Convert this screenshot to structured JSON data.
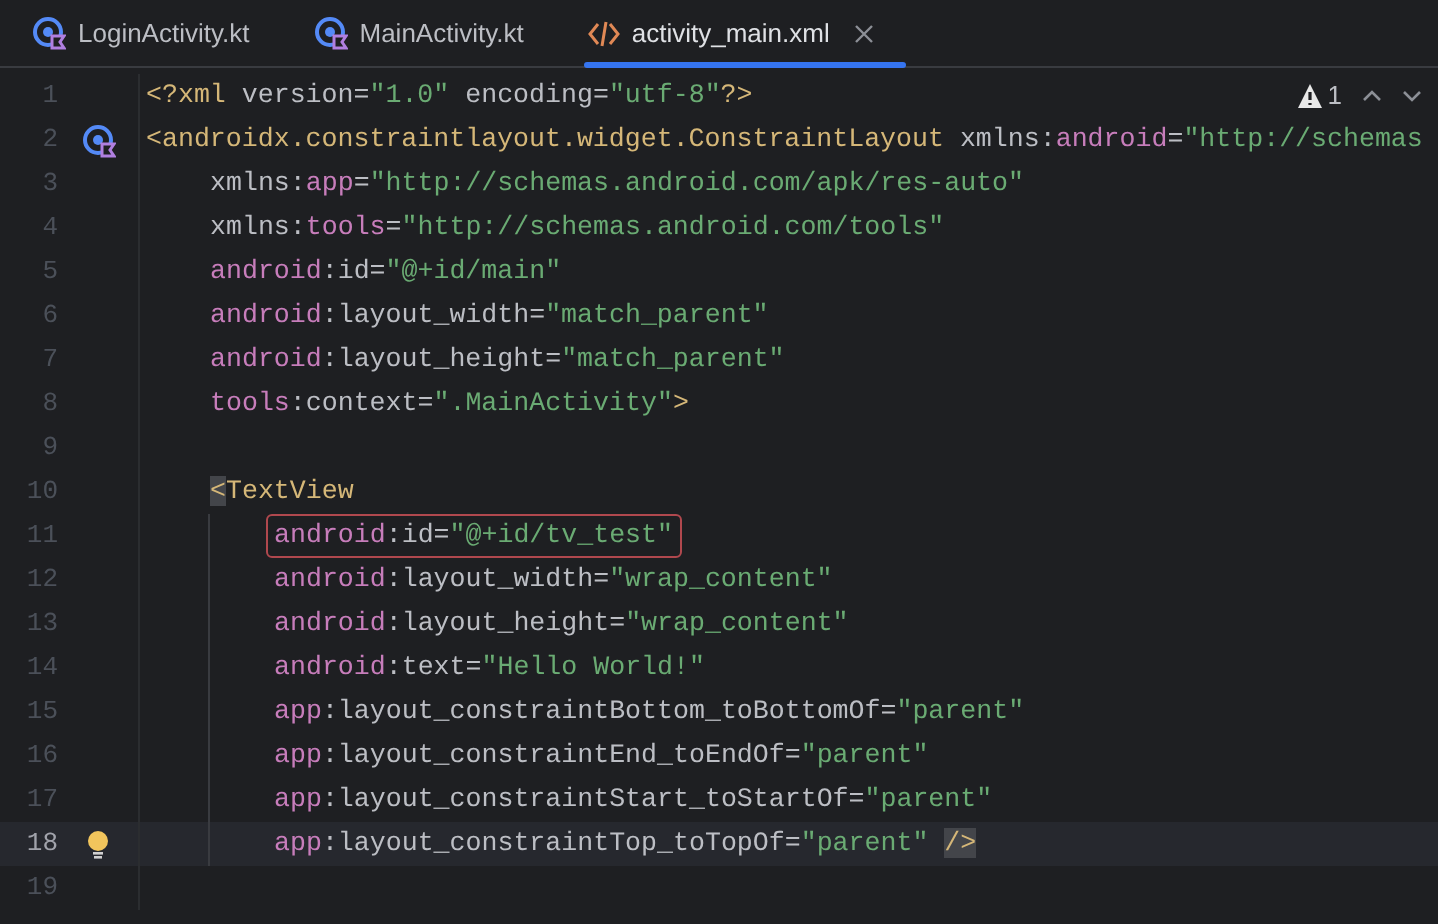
{
  "tabs": [
    {
      "label": "LoginActivity.kt",
      "kind": "kotlin",
      "selected": false,
      "closable": false
    },
    {
      "label": "MainActivity.kt",
      "kind": "kotlin",
      "selected": false,
      "closable": false
    },
    {
      "label": "activity_main.xml",
      "kind": "xml",
      "selected": true,
      "closable": true
    }
  ],
  "inspections": {
    "warning_count": "1"
  },
  "lines": [
    {
      "number": "1",
      "tokens": [
        {
          "kind": "tag",
          "text": "<?xml "
        },
        {
          "kind": "attr",
          "text": "version="
        },
        {
          "kind": "value",
          "text": "\"1.0\""
        },
        {
          "kind": "attr",
          "text": " encoding="
        },
        {
          "kind": "value",
          "text": "\"utf-8\""
        },
        {
          "kind": "tag",
          "text": "?>"
        }
      ]
    },
    {
      "number": "2",
      "gutter_icon": {
        "kind": "class"
      },
      "tokens": [
        {
          "kind": "tag",
          "text": "<androidx.constraintlayout.widget.ConstraintLayout "
        },
        {
          "kind": "attr",
          "text": "xmlns:"
        },
        {
          "kind": "ns",
          "text": "android"
        },
        {
          "kind": "attr",
          "text": "="
        },
        {
          "kind": "value",
          "text": "\"http://schemas"
        }
      ],
      "children": [
        {
          "number": "3",
          "tokens": [
            {
              "kind": "attr",
              "text": "xmlns:"
            },
            {
              "kind": "ns",
              "text": "app"
            },
            {
              "kind": "attr",
              "text": "="
            },
            {
              "kind": "value",
              "text": "\"http://schemas.android.com/apk/res-auto\""
            }
          ]
        },
        {
          "number": "4",
          "tokens": [
            {
              "kind": "attr",
              "text": "xmlns:"
            },
            {
              "kind": "ns",
              "text": "tools"
            },
            {
              "kind": "attr",
              "text": "="
            },
            {
              "kind": "value",
              "text": "\"http://schemas.android.com/tools\""
            }
          ]
        },
        {
          "number": "5",
          "tokens": [
            {
              "kind": "ns",
              "text": "android"
            },
            {
              "kind": "attr",
              "text": ":id="
            },
            {
              "kind": "value",
              "text": "\"@+id/main\""
            }
          ]
        },
        {
          "number": "6",
          "tokens": [
            {
              "kind": "ns",
              "text": "android"
            },
            {
              "kind": "attr",
              "text": ":layout_width="
            },
            {
              "kind": "value",
              "text": "\"match_parent\""
            }
          ]
        },
        {
          "number": "7",
          "tokens": [
            {
              "kind": "ns",
              "text": "android"
            },
            {
              "kind": "attr",
              "text": ":layout_height="
            },
            {
              "kind": "value",
              "text": "\"match_parent\""
            }
          ]
        },
        {
          "number": "8",
          "tokens": [
            {
              "kind": "ns",
              "text": "tools"
            },
            {
              "kind": "attr",
              "text": ":context="
            },
            {
              "kind": "value",
              "text": "\".MainActivity\""
            },
            {
              "kind": "tag",
              "text": ">"
            }
          ]
        },
        {
          "number": "9"
        },
        {
          "number": "10",
          "tokens": [
            {
              "kind": "tag",
              "text": "<",
              "matched": true
            },
            {
              "kind": "tag",
              "text": "TextView"
            }
          ],
          "children": [
            {
              "number": "11",
              "boxed": true,
              "tokens": [
                {
                  "kind": "ns",
                  "text": "android"
                },
                {
                  "kind": "attr",
                  "text": ":id="
                },
                {
                  "kind": "value",
                  "text": "\"@+id/tv_test\""
                }
              ]
            },
            {
              "number": "12",
              "tokens": [
                {
                  "kind": "ns",
                  "text": "android"
                },
                {
                  "kind": "attr",
                  "text": ":layout_width="
                },
                {
                  "kind": "value",
                  "text": "\"wrap_content\""
                }
              ]
            },
            {
              "number": "13",
              "tokens": [
                {
                  "kind": "ns",
                  "text": "android"
                },
                {
                  "kind": "attr",
                  "text": ":layout_height="
                },
                {
                  "kind": "value",
                  "text": "\"wrap_content\""
                }
              ]
            },
            {
              "number": "14",
              "tokens": [
                {
                  "kind": "ns",
                  "text": "android"
                },
                {
                  "kind": "attr",
                  "text": ":text="
                },
                {
                  "kind": "value",
                  "text": "\"Hello World!\""
                }
              ]
            },
            {
              "number": "15",
              "tokens": [
                {
                  "kind": "ns",
                  "text": "app"
                },
                {
                  "kind": "attr",
                  "text": ":layout_constraintBottom_toBottomOf="
                },
                {
                  "kind": "value",
                  "text": "\"parent\""
                }
              ]
            },
            {
              "number": "16",
              "tokens": [
                {
                  "kind": "ns",
                  "text": "app"
                },
                {
                  "kind": "attr",
                  "text": ":layout_constraintEnd_toEndOf="
                },
                {
                  "kind": "value",
                  "text": "\"parent\""
                }
              ]
            },
            {
              "number": "17",
              "tokens": [
                {
                  "kind": "ns",
                  "text": "app"
                },
                {
                  "kind": "attr",
                  "text": ":layout_constraintStart_toStartOf="
                },
                {
                  "kind": "value",
                  "text": "\"parent\""
                }
              ]
            },
            {
              "number": "18",
              "current": true,
              "gutter_icon": {
                "kind": "bulb"
              },
              "tokens": [
                {
                  "kind": "ns",
                  "text": "app"
                },
                {
                  "kind": "attr",
                  "text": ":layout_constraintTop_toTopOf="
                },
                {
                  "kind": "value",
                  "text": "\"parent\""
                },
                {
                  "kind": "tag",
                  "text": "/>",
                  "matched": true,
                  "spaced": true
                }
              ]
            }
          ]
        },
        {
          "number": "19"
        }
      ]
    }
  ]
}
